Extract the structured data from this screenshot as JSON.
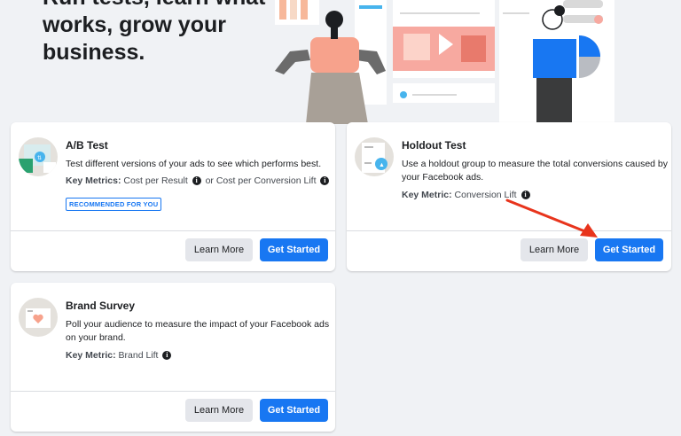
{
  "hero": {
    "title": "Run tests, learn what works, grow your business."
  },
  "cards": {
    "ab_test": {
      "title": "A/B Test",
      "description": "Test different versions of your ads to see which performs best.",
      "metric_label": "Key Metrics:",
      "metric_value": "Cost per Result",
      "metric_or": "or Cost per Conversion Lift",
      "badge": "RECOMMENDED FOR YOU",
      "learn_more": "Learn More",
      "get_started": "Get Started"
    },
    "holdout_test": {
      "title": "Holdout Test",
      "description_line1": "Use a holdout group to measure the total conversions caused by",
      "description_line2": "your Facebook ads.",
      "metric_label": "Key Metric:",
      "metric_value": "Conversion Lift",
      "learn_more": "Learn More",
      "get_started": "Get Started"
    },
    "brand_survey": {
      "title": "Brand Survey",
      "description_line1": "Poll your audience to measure the impact of your Facebook ads",
      "description_line2": "on your brand.",
      "metric_label": "Key Metric:",
      "metric_value": "Brand Lift",
      "learn_more": "Learn More",
      "get_started": "Get Started"
    }
  },
  "icons": {
    "info": "info-icon",
    "arrow": "red-arrow-annotation"
  },
  "colors": {
    "primary": "#1877f2",
    "annotation": "#e8341c",
    "background": "#f0f2f5"
  }
}
